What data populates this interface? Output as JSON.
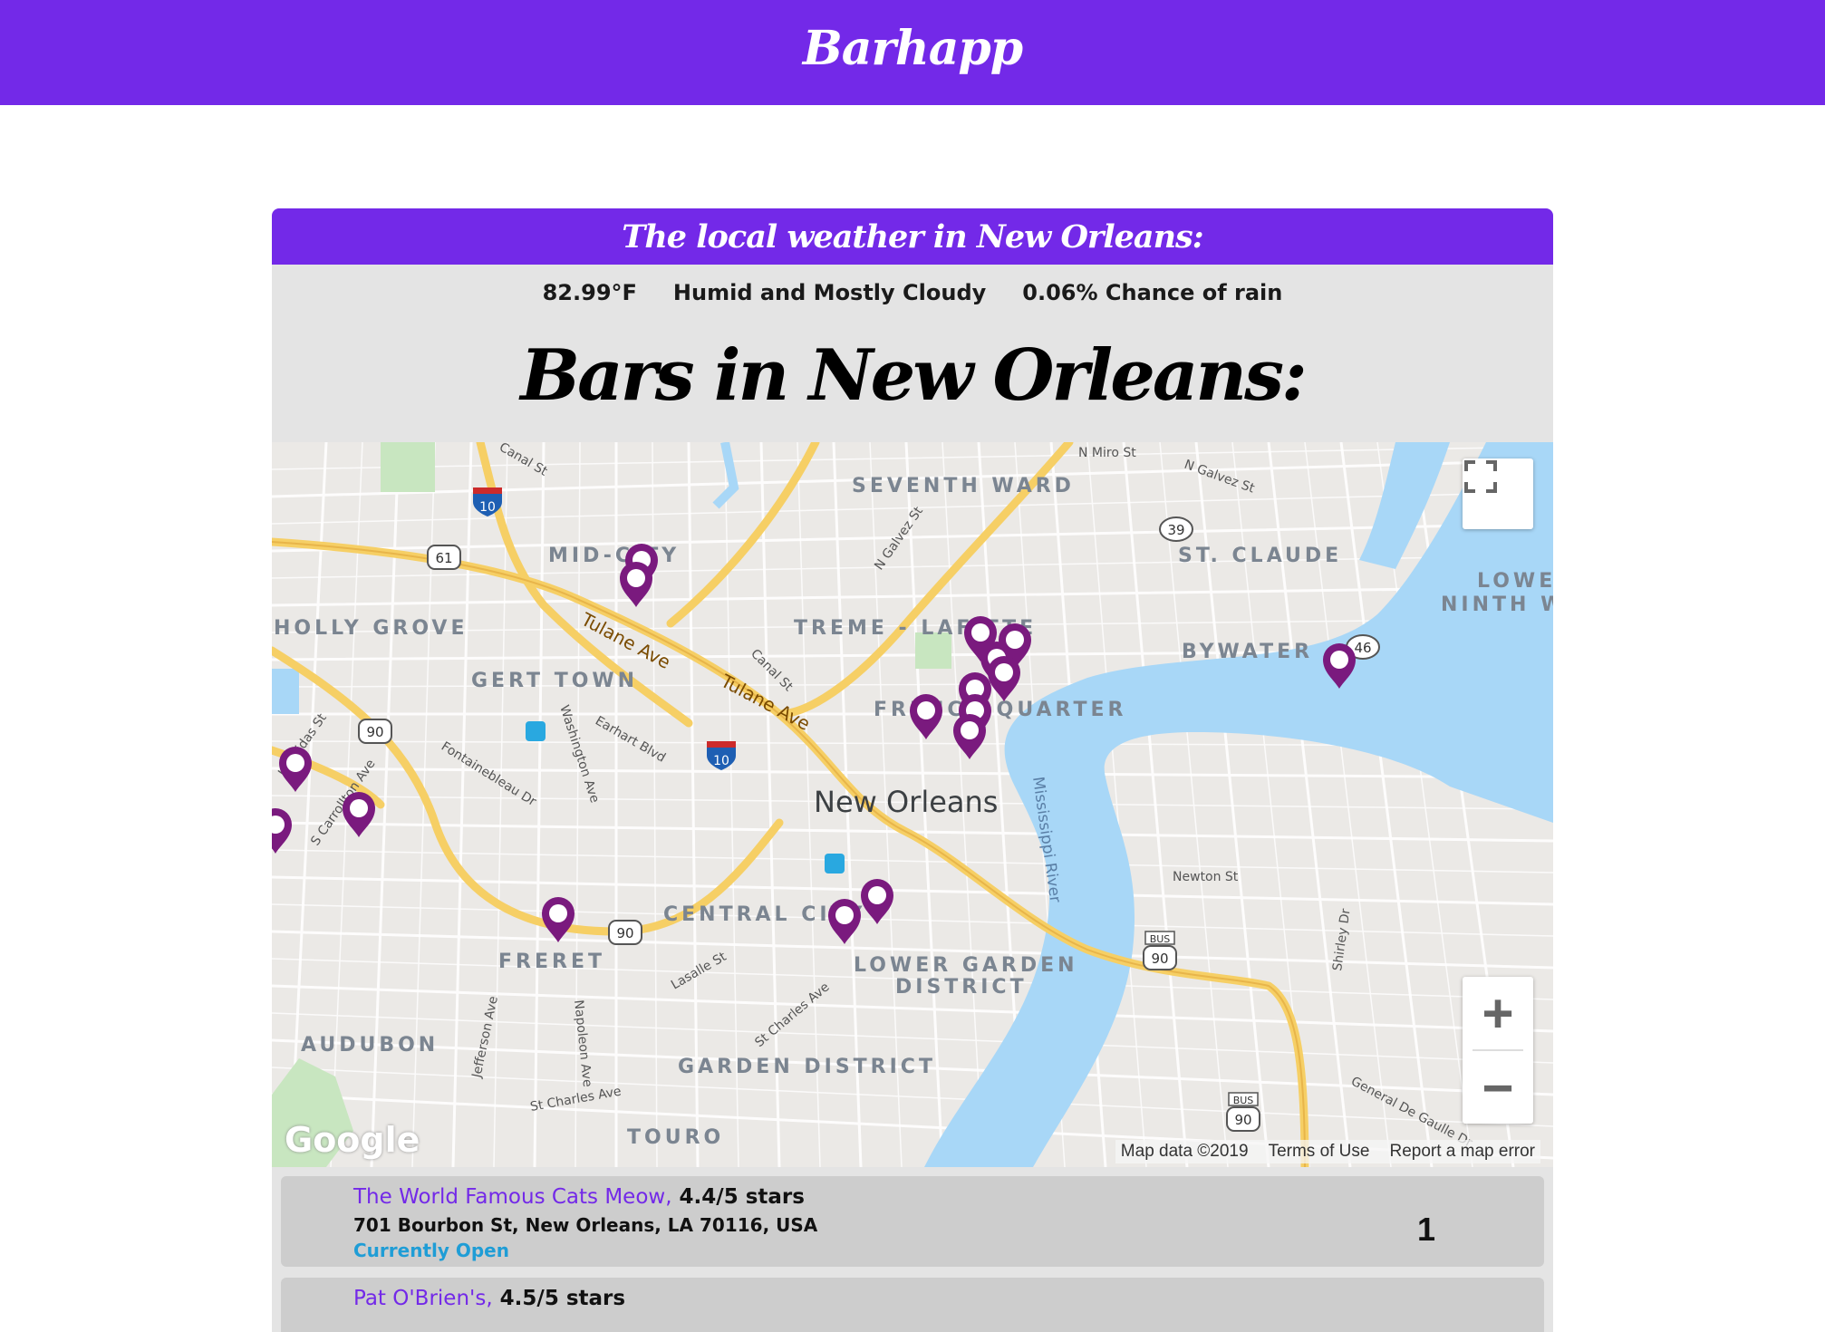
{
  "app": {
    "brand": "Barhapp"
  },
  "weather": {
    "heading": "The local weather in New Orleans:",
    "temp": "82.99°F",
    "summary": "Humid and Mostly Cloudy",
    "rain": "0.06% Chance of rain"
  },
  "bars_heading": "Bars in New Orleans:",
  "map": {
    "neighborhoods": [
      "SEVENTH WARD",
      "MID-CITY",
      "ST. CLAUDE",
      "LOWER",
      "NINTH W",
      "HOLLY GROVE",
      "TREME - LAFITTE",
      "BYWATER",
      "GERT TOWN",
      "FRENCH QUARTER",
      "CENTRAL CITY",
      "FRERET",
      "LOWER GARDEN",
      "DISTRICT",
      "AUDUBON",
      "GARDEN DISTRICT",
      "TOURO"
    ],
    "city_label": "New Orleans",
    "river_label": "Mississippi River",
    "streets": [
      "Canal St",
      "Tulane Ave",
      "Washington Ave",
      "Earhart Blvd",
      "Fontainebleau Dr",
      "S Carrollton Ave",
      "Leonidas St",
      "N Galvez St",
      "N Miro St",
      "Newton St",
      "Shirley Dr",
      "St Charles Ave",
      "Napoleon Ave",
      "Jefferson Ave",
      "Lasalle St",
      "General De Gaulle Dr"
    ],
    "shields": [
      "10",
      "61",
      "90",
      "39",
      "46",
      "90",
      "90",
      "90"
    ],
    "bus_label": "BUS",
    "google_label": "Google",
    "attribution": {
      "data": "Map data ©2019",
      "terms": "Terms of Use",
      "report": "Report a map error"
    },
    "zoom_in": "+",
    "zoom_out": "−",
    "pin_color": "#7a1a7e",
    "brand_color": "#7329e8"
  },
  "bars": [
    {
      "name": "The World Famous Cats Meow,",
      "rating": "4.4/5 stars",
      "address": "701 Bourbon St, New Orleans, LA 70116, USA",
      "status": "Currently Open",
      "rank": "1"
    },
    {
      "name": "Pat O'Brien's,",
      "rating": "4.5/5 stars"
    }
  ]
}
